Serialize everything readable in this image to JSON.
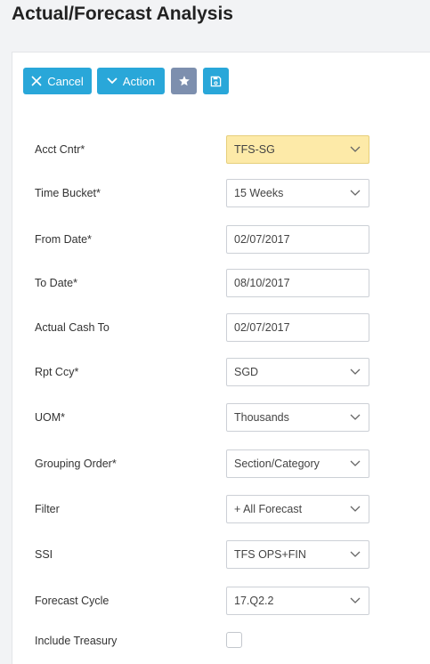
{
  "page": {
    "title": "Actual/Forecast Analysis"
  },
  "toolbar": {
    "cancel_label": "Cancel",
    "action_label": "Action",
    "favorite_icon": "star-icon",
    "save_icon": "save-icon",
    "colors": {
      "primary": "#29a7d9",
      "secondary": "#7d8fae",
      "highlight": "#fdeaa8"
    }
  },
  "form": {
    "acct_cntr": {
      "label": "Acct Cntr*",
      "value": "TFS-SG"
    },
    "time_bucket": {
      "label": "Time Bucket*",
      "value": "15 Weeks"
    },
    "from_date": {
      "label": "From Date*",
      "value": "02/07/2017"
    },
    "to_date": {
      "label": "To Date*",
      "value": "08/10/2017"
    },
    "actual_cash_to": {
      "label": "Actual Cash To",
      "value": "02/07/2017"
    },
    "rpt_ccy": {
      "label": "Rpt Ccy*",
      "value": "SGD"
    },
    "uom": {
      "label": "UOM*",
      "value": "Thousands"
    },
    "grouping_order": {
      "label": "Grouping Order*",
      "value": "Section/Category"
    },
    "filter": {
      "label": "Filter",
      "value": "+ All Forecast"
    },
    "ssi": {
      "label": "SSI",
      "value": "TFS OPS+FIN"
    },
    "forecast_cycle": {
      "label": "Forecast Cycle",
      "value": "17.Q2.2"
    },
    "include_treasury": {
      "label": "Include Treasury",
      "checked": false
    }
  }
}
